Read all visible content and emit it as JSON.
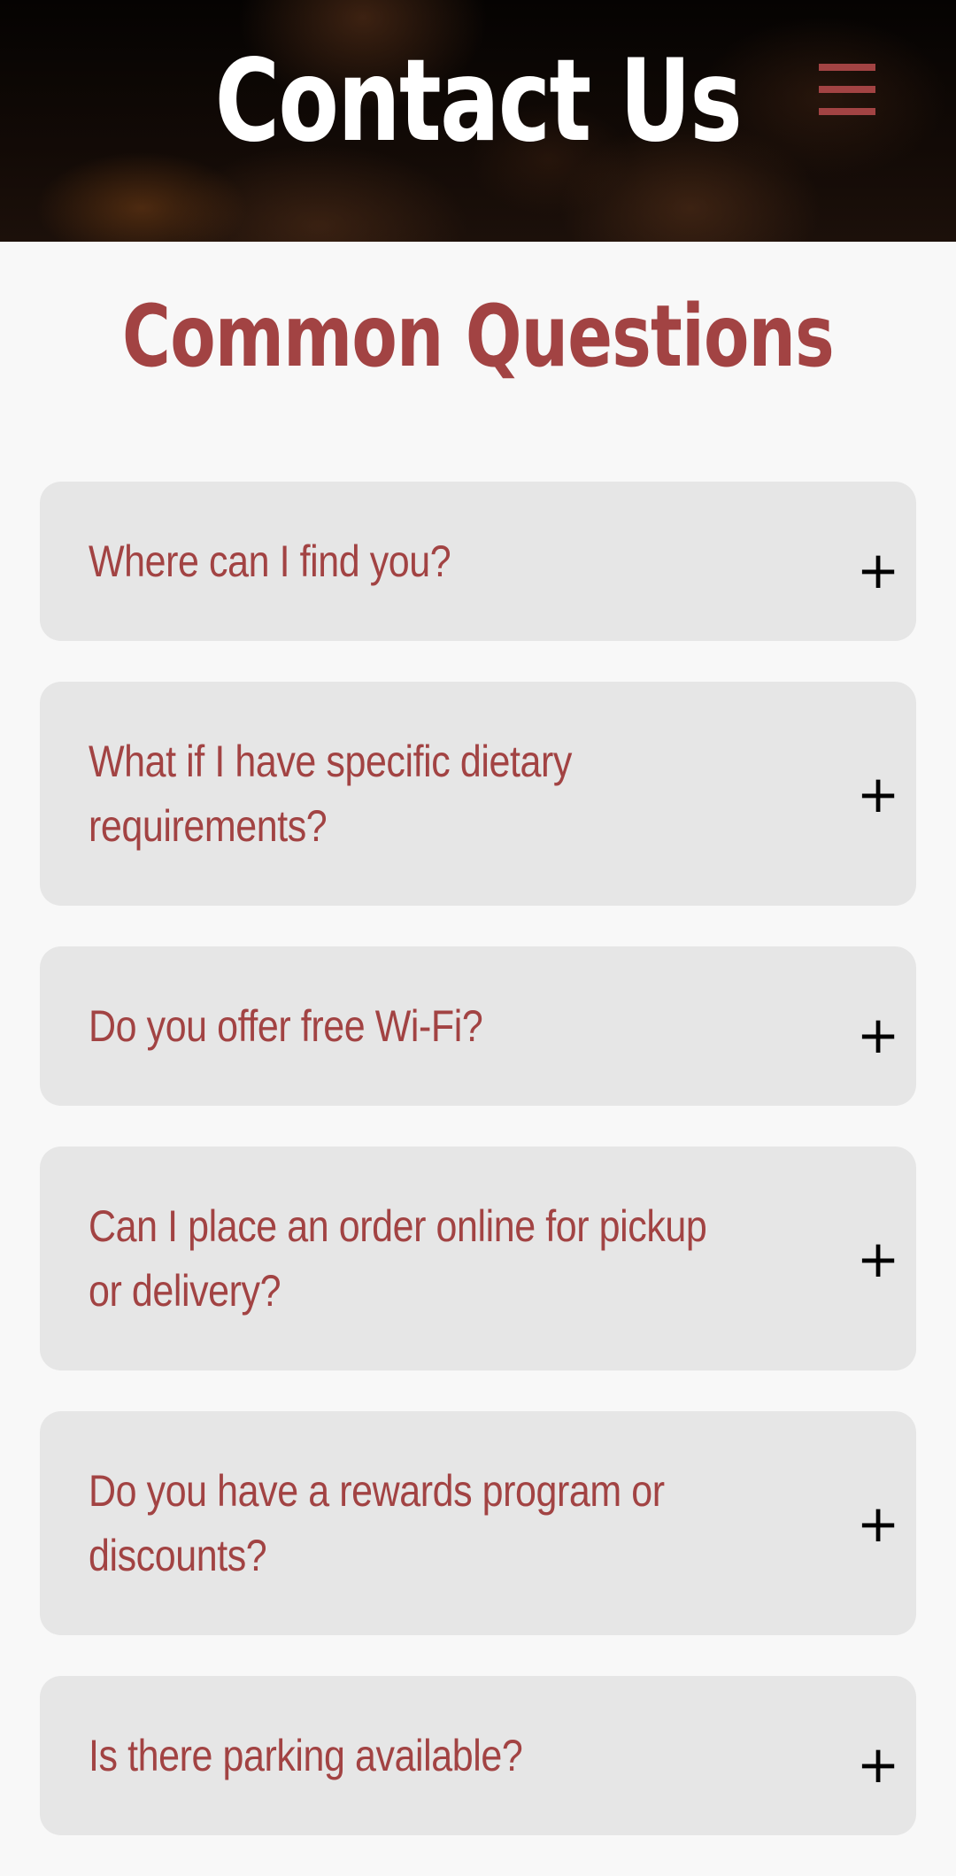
{
  "header": {
    "title": "Contact Us",
    "menu_icon": "hamburger-menu-icon",
    "accent_color": "#a24343"
  },
  "faq": {
    "heading": "Common Questions",
    "toggle_symbol": "+",
    "items": [
      {
        "question": "Where can I find you?"
      },
      {
        "question": "What if I have specific dietary requirements?"
      },
      {
        "question": "Do you offer free Wi-Fi?"
      },
      {
        "question": "Can I place an order online for pickup or delivery?"
      },
      {
        "question": "Do you have a rewards program or discounts?"
      },
      {
        "question": "Is there parking available?"
      }
    ]
  },
  "colors": {
    "page_background": "#f8f8f8",
    "card_background": "#e6e6e6",
    "question_text": "#a24343",
    "toggle_icon": "#000000",
    "hero_title": "#ffffff"
  }
}
